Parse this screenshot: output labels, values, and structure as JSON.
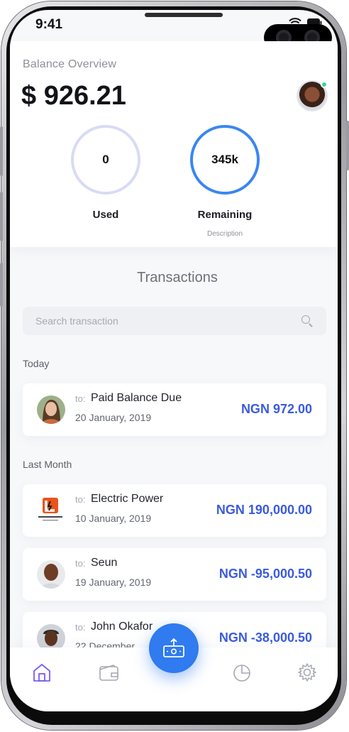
{
  "status_bar": {
    "time": "9:41"
  },
  "balance": {
    "title": "Balance Overview",
    "amount": "$ 926.21",
    "used": {
      "value": "0",
      "label": "Used"
    },
    "remaining": {
      "value": "345k",
      "label": "Remaining",
      "description": "Description"
    }
  },
  "transactions": {
    "heading": "Transactions",
    "search_placeholder": "Search transaction",
    "groups": [
      {
        "label": "Today",
        "items": [
          {
            "to": "to:",
            "name": "Paid Balance Due",
            "date": "20 January, 2019",
            "amount": "NGN 972.00"
          }
        ]
      },
      {
        "label": "Last Month",
        "items": [
          {
            "to": "to:",
            "name": "Electric Power",
            "date": "10 January, 2019",
            "amount": "NGN 190,000.00"
          },
          {
            "to": "to:",
            "name": "Seun",
            "date": "19 January, 2019",
            "amount": "NGN -95,000.50"
          },
          {
            "to": "to:",
            "name": "John Okafor",
            "date": "22 December",
            "amount": "NGN -38,000.50"
          }
        ]
      }
    ]
  },
  "tabbar": {
    "tabs": [
      {
        "icon": "home-icon",
        "active": true
      },
      {
        "icon": "wallet-icon",
        "active": false
      },
      {
        "icon": "pie-chart-icon",
        "active": false
      },
      {
        "icon": "settings-icon",
        "active": false
      }
    ],
    "fab_icon": "atm-withdraw-icon"
  },
  "colors": {
    "accent_blue": "#2f7bef",
    "amount_blue": "#3a5bdc",
    "active_tab": "#7b5cf0",
    "online": "#3dd598"
  }
}
